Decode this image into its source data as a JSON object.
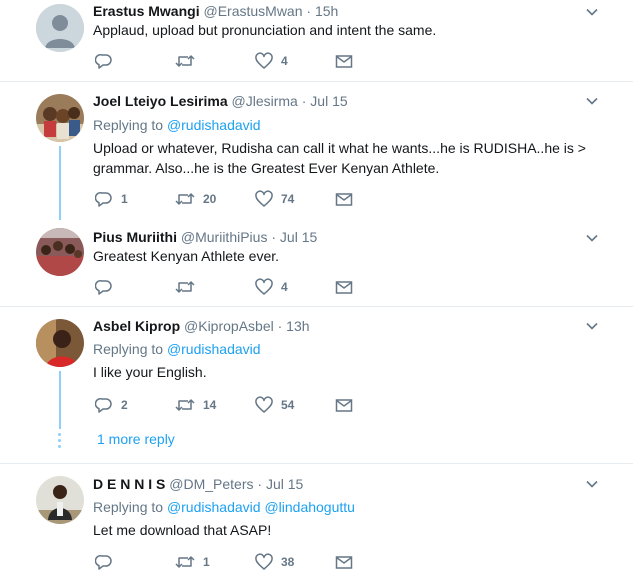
{
  "tweets": [
    {
      "name": "Erastus Mwangi",
      "handle": "@ErastusMwan",
      "dot": "·",
      "time": "15h",
      "text": "Applaud, upload but pronunciation and intent the same.",
      "replies": "",
      "retweets": "",
      "likes": "4"
    },
    {
      "name": "Joel Lteiyo Lesirima",
      "handle": "@Jlesirma",
      "dot": "·",
      "time": "Jul 15",
      "replying_label": "Replying to",
      "replying_to": [
        "@rudishadavid"
      ],
      "text": "Upload or whatever, Rudisha can call it what he wants...he is RUDISHA..he is > grammar. Also...he is the Greatest Ever Kenyan Athlete.",
      "replies": "1",
      "retweets": "20",
      "likes": "74"
    },
    {
      "name": "Pius Muriithi",
      "handle": "@MuriithiPius",
      "dot": "·",
      "time": "Jul 15",
      "text": "Greatest Kenyan Athlete ever.",
      "replies": "",
      "retweets": "",
      "likes": "4"
    },
    {
      "name": "Asbel Kiprop",
      "handle": "@KipropAsbel",
      "dot": "·",
      "time": "13h",
      "replying_label": "Replying to",
      "replying_to": [
        "@rudishadavid"
      ],
      "text": "I like your English.",
      "replies": "2",
      "retweets": "14",
      "likes": "54"
    },
    {
      "name": "D E N N I S",
      "handle": "@DM_Peters",
      "dot": "·",
      "time": "Jul 15",
      "replying_label": "Replying to",
      "replying_to": [
        "@rudishadavid",
        "@lindahoguttu"
      ],
      "text": "Let me download that ASAP!",
      "replies": "",
      "retweets": "1",
      "likes": "38"
    }
  ],
  "more_replies_label": "1 more reply",
  "colors": {
    "accent": "#1da1f2",
    "muted": "#657786",
    "thread": "#8ed0f9",
    "separator": "#e6ecf0"
  },
  "icons": [
    "reply-icon",
    "retweet-icon",
    "like-icon",
    "message-icon",
    "chevron-down-icon"
  ]
}
